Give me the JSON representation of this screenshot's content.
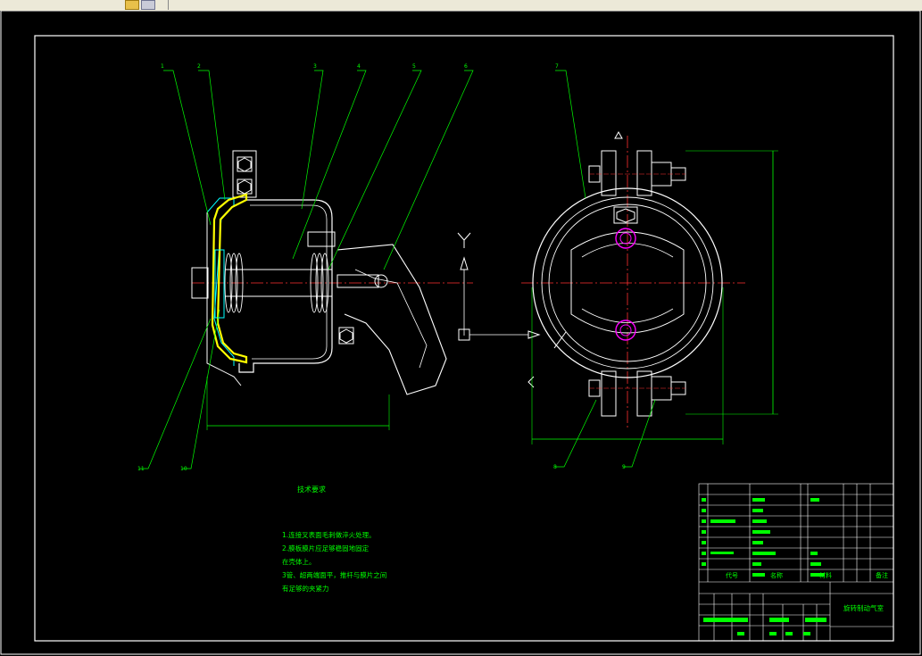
{
  "toolbar": {
    "icons": [
      "open-folder-icon",
      "layers-icon"
    ]
  },
  "title_block": {
    "col_headers": [
      "代号",
      "名称",
      "材料",
      "备注"
    ],
    "drawing_name": "旋转制动气室"
  },
  "technical_requirements": {
    "title": "技术要求",
    "lines": [
      "1.连接叉表面毛刺做淬火处理。",
      "2.膜板膜片应足够稳固地固定",
      "  在壳体上。",
      "3管、超两端面平，推杆与膜片之间",
      "  有足够的夹紧力"
    ]
  },
  "colors": {
    "background": "#000000",
    "line_white": "#ffffff",
    "line_green": "#00ff00",
    "center_red": "#ff3030",
    "highlight_yellow": "#ffff00",
    "cyan": "#00ffff",
    "magenta": "#ff00ff"
  }
}
